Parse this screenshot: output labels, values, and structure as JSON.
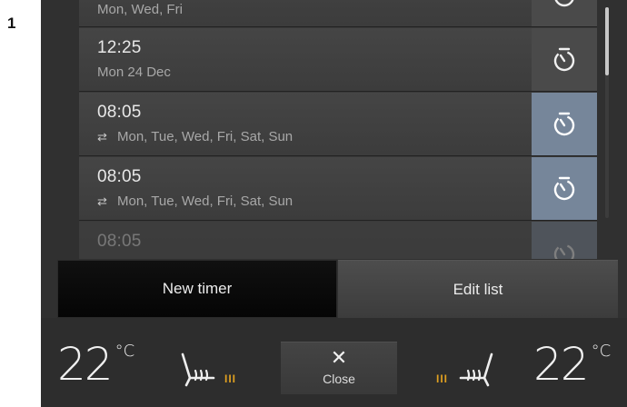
{
  "callout_number": "1",
  "timers": [
    {
      "time": "",
      "days": "Mon, Wed, Fri",
      "repeat": false,
      "active": false,
      "partial": "top"
    },
    {
      "time": "12:25",
      "days": "Mon 24 Dec",
      "repeat": false,
      "active": false
    },
    {
      "time": "08:05",
      "days": "Mon, Tue, Wed, Fri, Sat, Sun",
      "repeat": true,
      "active": true
    },
    {
      "time": "08:05",
      "days": "Mon, Tue, Wed, Fri, Sat, Sun",
      "repeat": true,
      "active": true
    },
    {
      "time": "08:05",
      "days": "",
      "repeat": false,
      "active": true,
      "partial": "bottom"
    }
  ],
  "actions": {
    "new_timer": "New timer",
    "edit_list": "Edit list"
  },
  "climate": {
    "left_temp": "22",
    "right_temp": "22",
    "unit": "°C",
    "left_seat_level": "III",
    "right_seat_level": "III",
    "close_label": "Close"
  },
  "colors": {
    "active_timer_bg": "#76869a",
    "seat_heat_indicator": "#e0a020"
  },
  "icons": {
    "timer": "stopwatch-icon",
    "repeat": "repeat-icon",
    "close": "close-icon",
    "seat_heat": "seat-heating-icon"
  }
}
